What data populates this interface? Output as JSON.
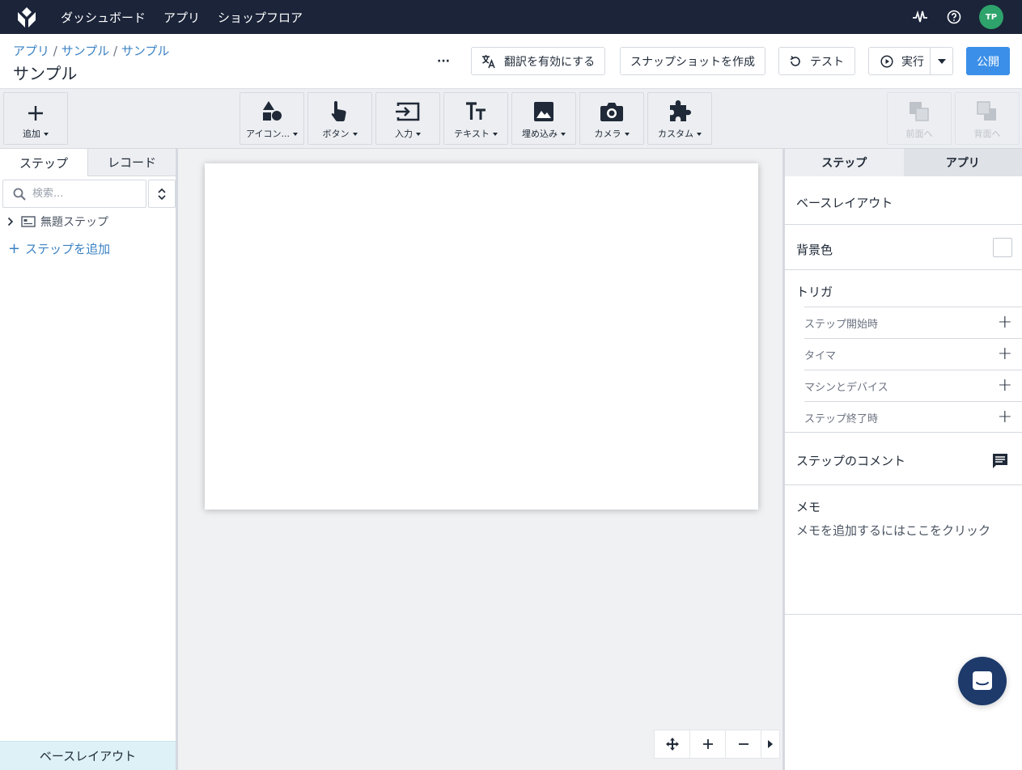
{
  "topnav": {
    "items": [
      "ダッシュボード",
      "アプリ",
      "ショップフロア"
    ],
    "avatar": "TP"
  },
  "header": {
    "breadcrumbs": [
      "アプリ",
      "サンプル",
      "サンプル"
    ],
    "separator": "/",
    "title": "サンプル",
    "more": "···",
    "translate_label": "翻訳を有効にする",
    "snapshot_label": "スナップショットを作成",
    "test_label": "テスト",
    "run_label": "実行",
    "publish_label": "公開"
  },
  "toolbar": {
    "add": "追加",
    "icons": "アイコン...",
    "button": "ボタン",
    "input": "入力",
    "text": "テキスト",
    "embed": "埋め込み",
    "camera": "カメラ",
    "custom": "カスタム",
    "front": "前面へ",
    "back": "背面へ"
  },
  "left": {
    "tabs": [
      "ステップ",
      "レコード"
    ],
    "search_placeholder": "検索...",
    "step_name": "無題ステップ",
    "add_step": "ステップを追加",
    "base_layout": "ベースレイアウト"
  },
  "right": {
    "tabs": [
      "ステップ",
      "アプリ"
    ],
    "base_layout": "ベースレイアウト",
    "bg_color": "背景色",
    "trigger": "トリガ",
    "triggers": [
      "ステップ開始時",
      "タイマ",
      "マシンとデバイス",
      "ステップ終了時"
    ],
    "comment": "ステップのコメント",
    "memo": "メモ",
    "memo_hint": "メモを追加するにはここをクリック"
  },
  "colors": {
    "nav_bg": "#1b2439",
    "accent": "#3b8fe8",
    "link": "#3b82c4",
    "avatar": "#2ea36b"
  }
}
